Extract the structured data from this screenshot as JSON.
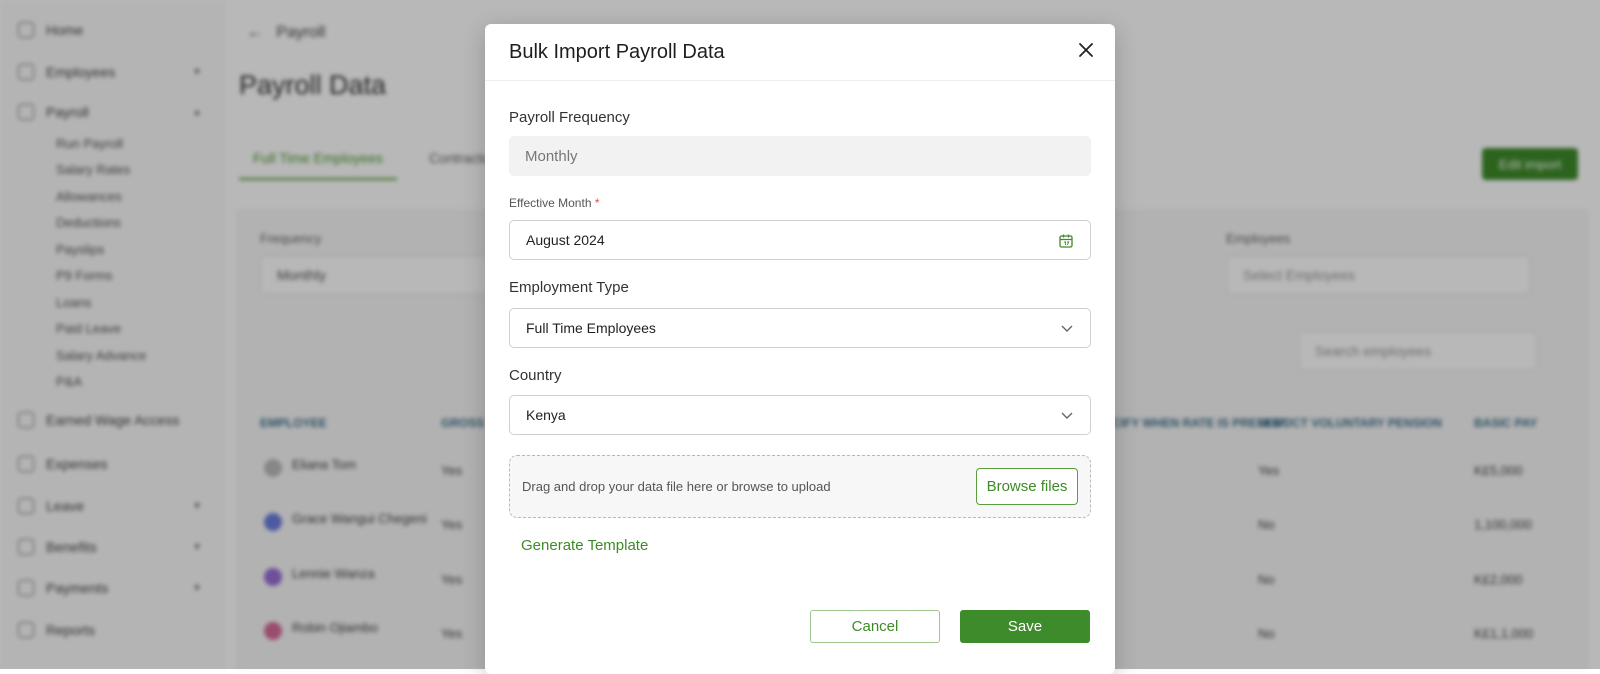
{
  "sidebar": {
    "items": [
      {
        "label": "Home"
      },
      {
        "label": "Employees"
      },
      {
        "label": "Payroll"
      },
      {
        "label": "Earned Wage Access"
      },
      {
        "label": "Expenses"
      },
      {
        "label": "Leave"
      },
      {
        "label": "Benefits"
      },
      {
        "label": "Payments"
      },
      {
        "label": "Reports"
      }
    ],
    "payroll_sub": [
      "Run Payroll",
      "Salary Rates",
      "Allowances",
      "Deductions",
      "Payslips",
      "P9 Forms",
      "Loans",
      "Paid Leave",
      "Salary Advance",
      "P&A"
    ]
  },
  "header": {
    "breadcrumb": "Payroll",
    "title": "Payroll Data"
  },
  "tabs": [
    "Full Time Employees",
    "Contractors"
  ],
  "edit_button": "Edit import",
  "filters": {
    "frequency_label": "Frequency",
    "frequency_value": "Monthly",
    "employees_label": "Employees",
    "employees_placeholder": "Select Employees",
    "search_placeholder": "Search employees"
  },
  "table": {
    "headers": [
      "EMPLOYEE",
      "GROSS",
      "SPECIFY WHEN RATE IS PRESENT",
      "DEDUCT VOLUNTARY PENSION",
      "BASIC PAY"
    ],
    "rows": [
      {
        "name": "Eliana Tom",
        "col1": "Yes",
        "col2": "Yes",
        "col3": "K£5,000"
      },
      {
        "name": "Grace Wangui Chegeni",
        "col1": "Yes",
        "col2": "No",
        "col3": "1,100,000"
      },
      {
        "name": "Lennie Wanza",
        "col1": "Yes",
        "col2": "No",
        "col3": "K£2,000"
      },
      {
        "name": "Robin Ojiambo",
        "col1": "Yes",
        "col2": "No",
        "col3": "K£1,1,000"
      }
    ]
  },
  "modal": {
    "title": "Bulk Import Payroll Data",
    "payroll_frequency_label": "Payroll Frequency",
    "payroll_frequency_value": "Monthly",
    "effective_month_label": "Effective Month",
    "required_mark": "*",
    "effective_month_value": "August 2024",
    "employment_type_label": "Employment Type",
    "employment_type_value": "Full Time Employees",
    "country_label": "Country",
    "country_value": "Kenya",
    "drop_text": "Drag and drop your data file here or browse to upload",
    "browse_label": "Browse files",
    "generate_label": "Generate Template",
    "cancel_label": "Cancel",
    "save_label": "Save"
  },
  "colors": {
    "accent": "#3d8b2b",
    "accent_text": "#3f8a28",
    "required": "#d9534f"
  },
  "icons": [
    "close-icon",
    "calendar-icon",
    "chevron-down-icon"
  ]
}
